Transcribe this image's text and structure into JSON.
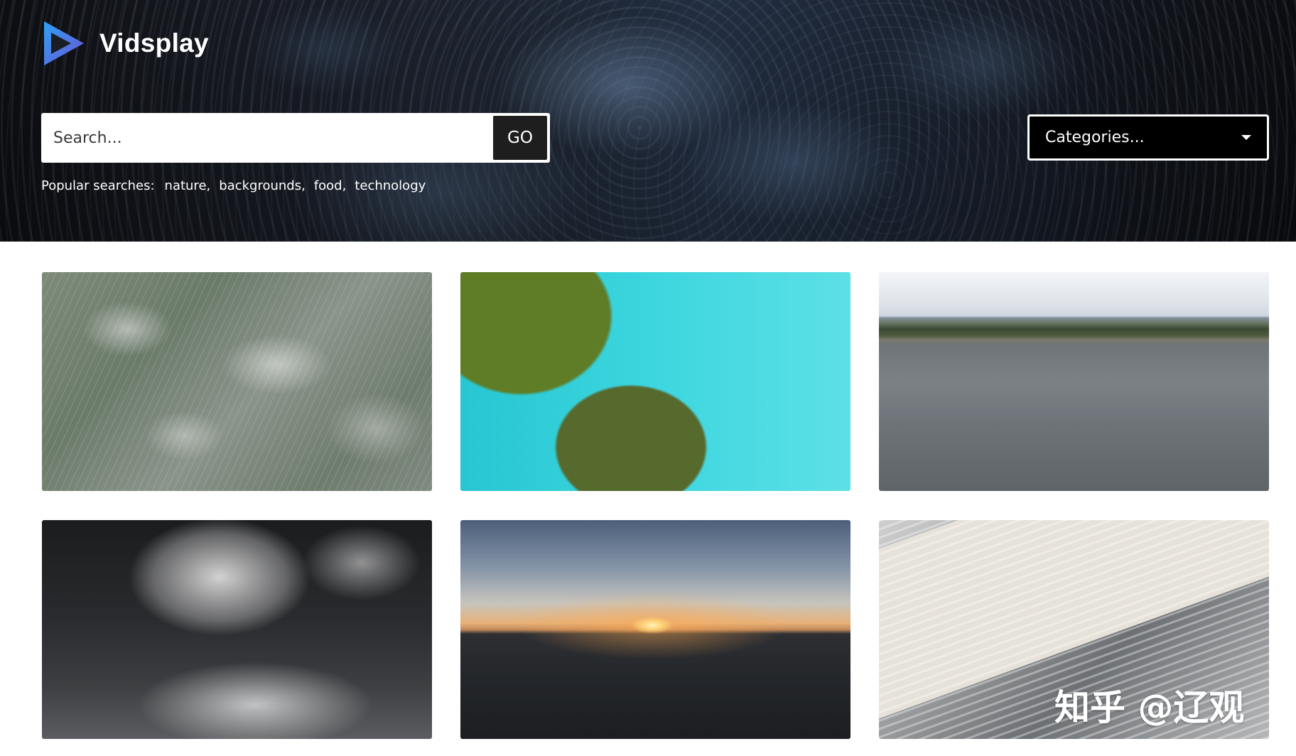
{
  "brand": {
    "name": "Vidsplay"
  },
  "search": {
    "placeholder": "Search...",
    "go_label": "GO"
  },
  "popular": {
    "label": "Popular searches:",
    "terms": [
      "nature,",
      "backgrounds,",
      "food,",
      "technology"
    ]
  },
  "categories": {
    "label": "Categories..."
  },
  "grid": {
    "tiles": [
      {
        "subject": "rain on trees"
      },
      {
        "subject": "green orbs in turquoise water"
      },
      {
        "subject": "lake and mountains"
      },
      {
        "subject": "icy stream"
      },
      {
        "subject": "ocean sunset"
      },
      {
        "subject": "printing press"
      }
    ]
  },
  "watermark": {
    "text": "知乎 @辽观"
  },
  "colors": {
    "logo_blue": "#3d7bf0",
    "logo_purple": "#6a54d6",
    "go_bg": "#1e1e1e",
    "select_bg": "#000000"
  }
}
